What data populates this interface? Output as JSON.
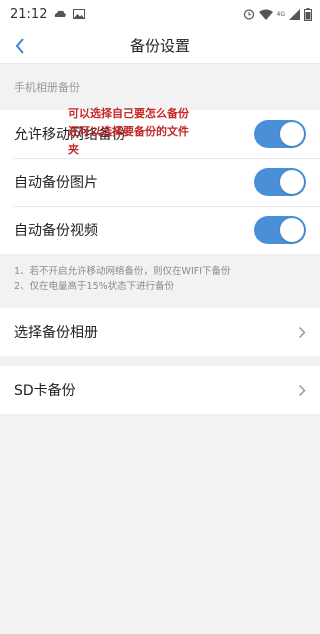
{
  "status_bar": {
    "time": "21:12",
    "left_icons": [
      "cloud-icon",
      "image-icon"
    ],
    "right_icons": [
      "alarm-icon",
      "wifi-icon",
      "cell-signal-icon",
      "battery-icon"
    ],
    "network": "4G"
  },
  "nav": {
    "title": "备份设置"
  },
  "section": {
    "header": "手机相册备份"
  },
  "settings": [
    {
      "label": "允许移动网络备份",
      "enabled": true
    },
    {
      "label": "自动备份图片",
      "enabled": true
    },
    {
      "label": "自动备份视频",
      "enabled": true
    }
  ],
  "notes": [
    "1、若不开启允许移动网络备份，则仅在WIFI下备份",
    "2、仅在电量高于15%状态下进行备份"
  ],
  "links": [
    {
      "label": "选择备份相册"
    },
    {
      "label": "SD卡备份"
    }
  ],
  "annotation": {
    "text": "可以选择自己要怎么备份还可以选择要备份的文件夹"
  },
  "colors": {
    "accent": "#4a90d9",
    "annotation": "#c62828"
  }
}
